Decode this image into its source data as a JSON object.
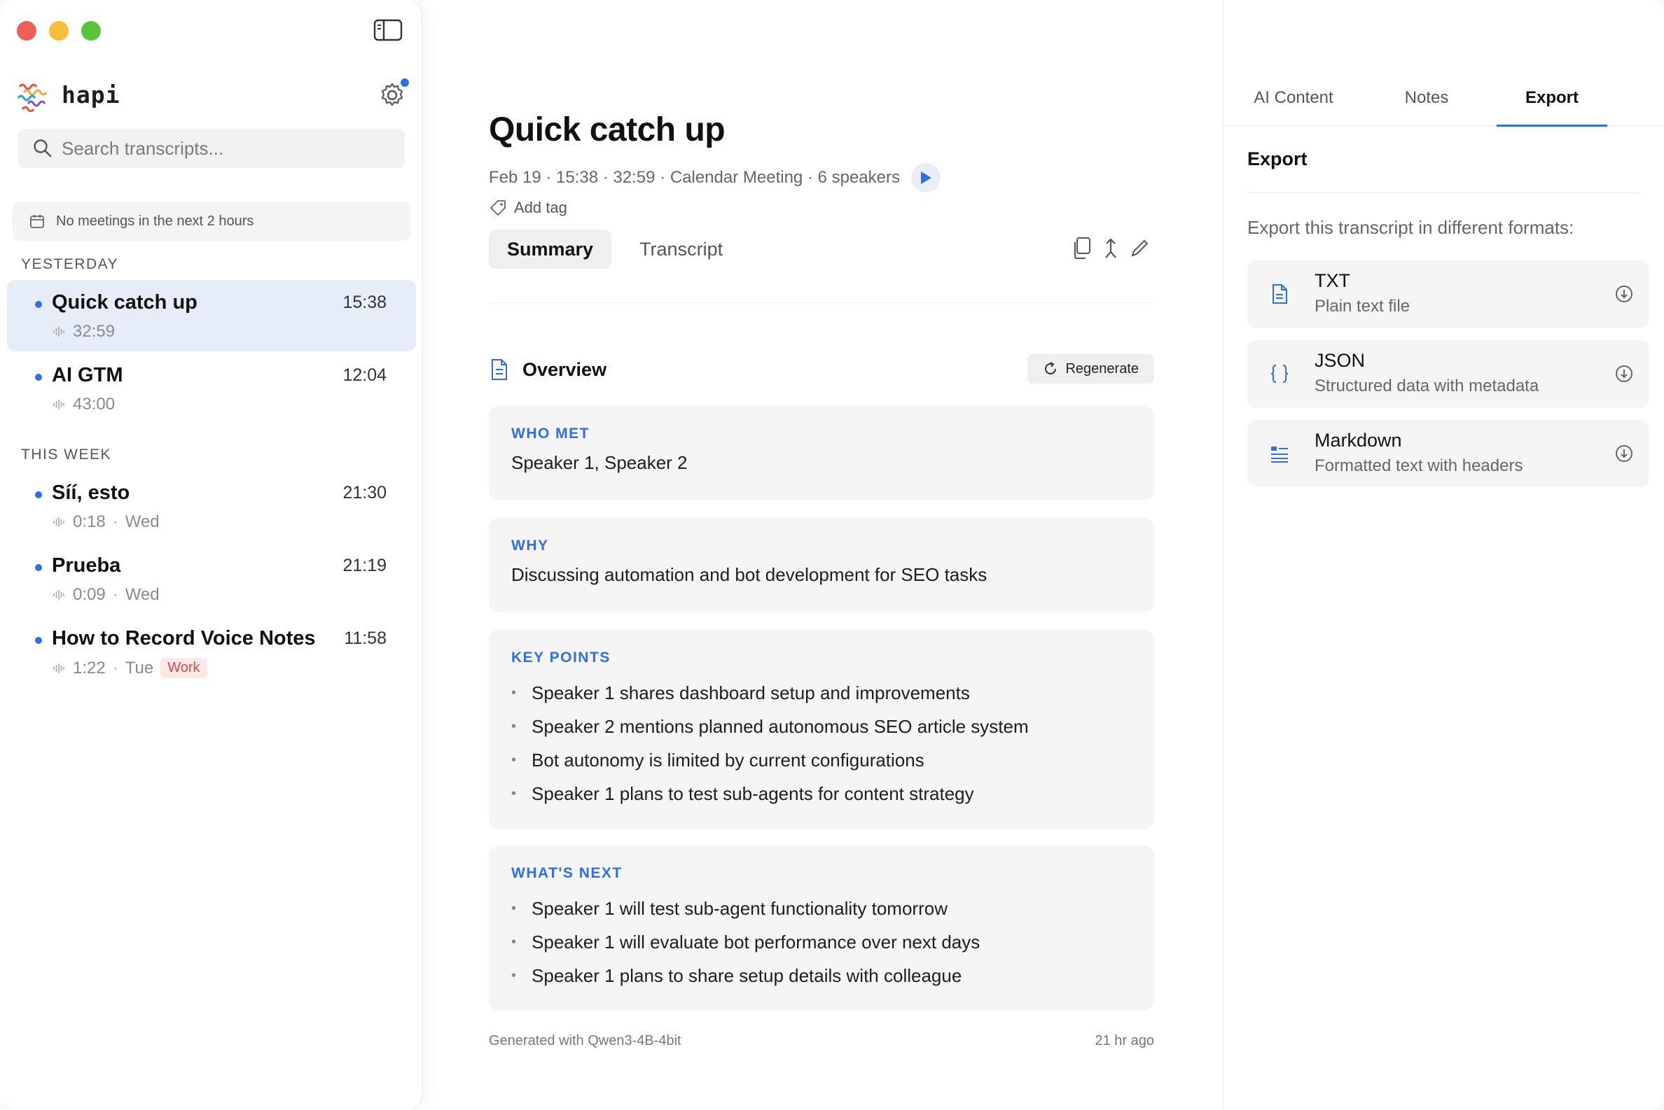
{
  "app": {
    "name": "hapi"
  },
  "search": {
    "placeholder": "Search transcripts..."
  },
  "calendar": {
    "status": "No meetings in the next 2 hours"
  },
  "sections": [
    {
      "label": "YESTERDAY"
    },
    {
      "label": "THIS WEEK"
    }
  ],
  "meetings": [
    {
      "title": "Quick catch up",
      "time": "15:38",
      "duration": "32:59",
      "day": "",
      "tag": ""
    },
    {
      "title": "AI GTM",
      "time": "12:04",
      "duration": "43:00",
      "day": "",
      "tag": ""
    },
    {
      "title": "Síí, esto",
      "time": "21:30",
      "duration": "0:18",
      "day": "Wed",
      "tag": ""
    },
    {
      "title": "Prueba",
      "time": "21:19",
      "duration": "0:09",
      "day": "Wed",
      "tag": ""
    },
    {
      "title": "How to Record Voice Notes",
      "time": "11:58",
      "duration": "1:22",
      "day": "Tue",
      "tag": "Work"
    }
  ],
  "main": {
    "title": "Quick catch up",
    "subline": "Feb 19 · 15:38 · 32:59 · Calendar Meeting · 6 speakers",
    "add_tag": "Add tag",
    "tabs": [
      "Summary",
      "Transcript"
    ],
    "overview_title": "Overview",
    "regenerate": "Regenerate",
    "who_met": {
      "label": "WHO MET",
      "text": "Speaker 1, Speaker 2"
    },
    "why": {
      "label": "WHY",
      "text": "Discussing automation and bot development for SEO tasks"
    },
    "key_points": {
      "label": "KEY POINTS",
      "items": [
        "Speaker 1 shares dashboard setup and improvements",
        "Speaker 2 mentions planned autonomous SEO article system",
        "Bot autonomy is limited by current configurations",
        "Speaker 1 plans to test sub-agents for content strategy"
      ]
    },
    "whats_next": {
      "label": "WHAT'S NEXT",
      "items": [
        "Speaker 1 will test sub-agent functionality tomorrow",
        "Speaker 1 will evaluate bot performance over next days",
        "Speaker 1 plans to share setup details with colleague"
      ]
    },
    "footer_model": "Generated with Qwen3-4B-4bit",
    "footer_time": "21 hr ago"
  },
  "right": {
    "tabs": [
      "AI Content",
      "Notes",
      "Export"
    ],
    "heading": "Export",
    "description": "Export this transcript in different formats:",
    "formats": [
      {
        "name": "TXT",
        "desc": "Plain text file",
        "icon": "document-icon"
      },
      {
        "name": "JSON",
        "desc": "Structured data with metadata",
        "icon": "braces-icon"
      },
      {
        "name": "Markdown",
        "desc": "Formatted text with headers",
        "icon": "markdown-list-icon"
      }
    ]
  },
  "colors": {
    "accent": "#2f6fe0",
    "tag_work_bg": "#fde8e8",
    "tag_work_text": "#d24a4a"
  }
}
